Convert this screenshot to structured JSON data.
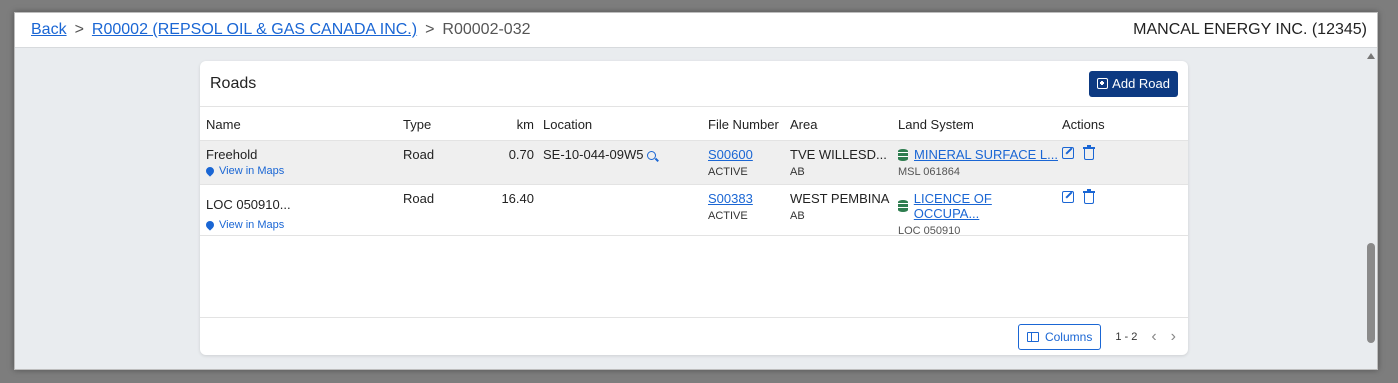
{
  "breadcrumb": {
    "back": "Back",
    "sep": ">",
    "parent": "R00002 (REPSOL OIL & GAS CANADA INC.)",
    "current": "R00002-032"
  },
  "company": "MANCAL ENERGY INC. (12345)",
  "card": {
    "title": "Roads",
    "add_button": "Add Road"
  },
  "columns": [
    "Name",
    "Type",
    "km",
    "Location",
    "File Number",
    "Area",
    "Land System",
    "Actions"
  ],
  "rows": [
    {
      "name": "Freehold",
      "maps_link": "View in Maps",
      "type": "Road",
      "km": "0.70",
      "location": "SE-10-044-09W5",
      "file_number": "S00600",
      "file_status": "ACTIVE",
      "area": "TVE WILLESD...",
      "area_sub": "AB",
      "land_system": "MINERAL SURFACE L...",
      "land_sub": "MSL 061864"
    },
    {
      "name": "LOC 050910...",
      "maps_link": "View in Maps",
      "type": "Road",
      "km": "16.40",
      "location": "",
      "file_number": "S00383",
      "file_status": "ACTIVE",
      "area": "WEST PEMBINA",
      "area_sub": "AB",
      "land_system": "LICENCE OF OCCUPA...",
      "land_sub": "LOC 050910"
    }
  ],
  "footer": {
    "columns_button": "Columns",
    "range": "1 - 2",
    "prev": "‹",
    "next": "›"
  },
  "colors": {
    "accent": "#1a66d4",
    "primary_button": "#0d3a82",
    "db_icon": "#2e7d4f"
  }
}
